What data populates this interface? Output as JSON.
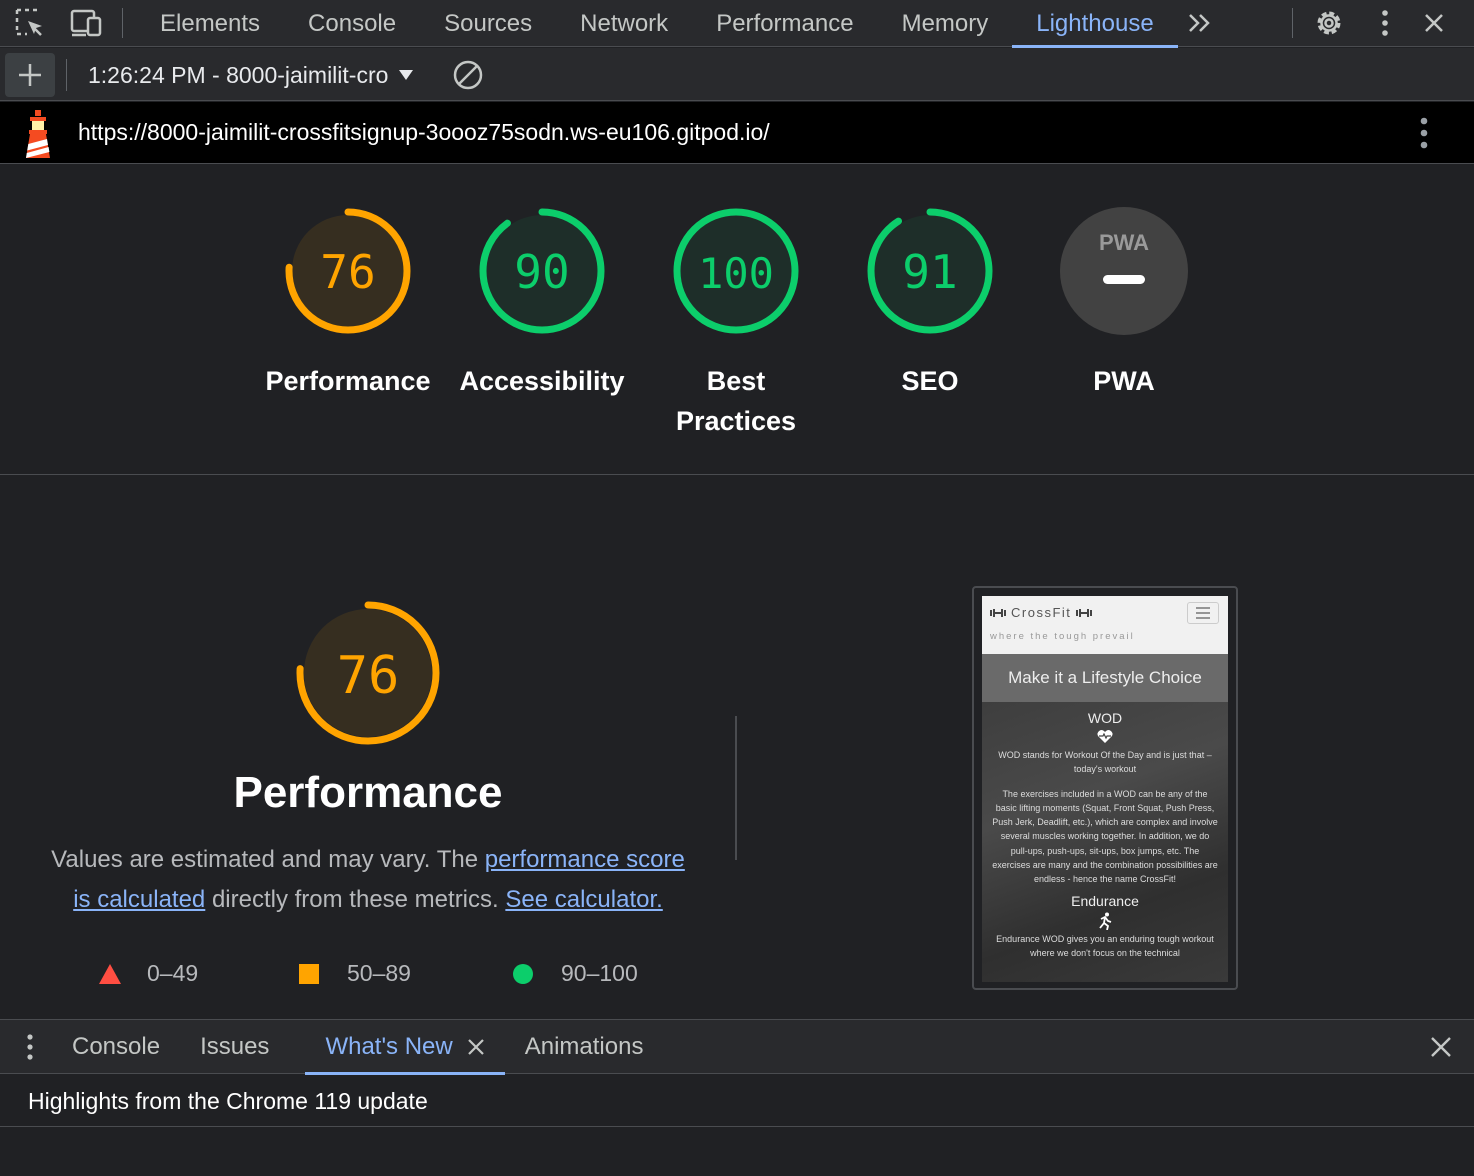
{
  "colors": {
    "pass": "#0cce6b",
    "average": "#ffa400",
    "fail": "#ff4e42",
    "accent": "#8ab4f8"
  },
  "devtools": {
    "icons": [
      "inspect-element-icon",
      "device-toolbar-icon",
      "more-tabs-icon",
      "settings-icon",
      "more-options-icon",
      "close-icon"
    ],
    "tabs": [
      {
        "label": "Elements"
      },
      {
        "label": "Console"
      },
      {
        "label": "Sources"
      },
      {
        "label": "Network"
      },
      {
        "label": "Performance"
      },
      {
        "label": "Memory"
      },
      {
        "label": "Lighthouse",
        "active": true
      }
    ]
  },
  "lighthouse_toolbar": {
    "report_label": "1:26:24 PM - 8000-jaimilit-cro"
  },
  "report": {
    "url": "https://8000-jaimilit-crossfitsignup-3oooz75sodn.ws-eu106.gitpod.io/",
    "categories": [
      {
        "label": "Performance",
        "score": 76,
        "rating": "average"
      },
      {
        "label": "Accessibility",
        "score": 90,
        "rating": "pass"
      },
      {
        "label_line1": "Best",
        "label_line2": "Practices",
        "score": 100,
        "rating": "pass"
      },
      {
        "label": "SEO",
        "score": 91,
        "rating": "pass"
      },
      {
        "label": "PWA",
        "badge": "PWA",
        "rating": "na"
      }
    ],
    "performance": {
      "score": 76,
      "title": "Performance",
      "desc_before": "Values are estimated and may vary. The ",
      "link1": "performance score is calculated",
      "desc_middle": " directly from these metrics. ",
      "link2": "See calculator.",
      "legend": [
        {
          "range": "0–49",
          "shape": "triangle"
        },
        {
          "range": "50–89",
          "shape": "square"
        },
        {
          "range": "90–100",
          "shape": "circle"
        }
      ]
    },
    "screenshot": {
      "brand": "CrossFit",
      "tagline": "where the tough prevail",
      "heading": "Make it a Lifestyle Choice",
      "section1_title": "WOD",
      "section1_p1": "WOD stands for Workout Of the Day and is just that – today's workout",
      "section1_p2": "The exercises included in a WOD can be any of the basic lifting moments (Squat, Front Squat, Push Press, Push Jerk, Deadlift, etc.), which are complex and involve several muscles working together. In addition, we do pull-ups, push-ups, sit-ups, box jumps, etc. The exercises are many and the combination possibilities are endless - hence the name CrossFit!",
      "section2_title": "Endurance",
      "section2_p1": "Endurance WOD gives you an enduring tough workout where we don't focus on the technical"
    }
  },
  "drawer": {
    "tabs": [
      {
        "label": "Console"
      },
      {
        "label": "Issues"
      },
      {
        "label": "What's New",
        "active": true,
        "closable": true
      },
      {
        "label": "Animations"
      }
    ],
    "content": "Highlights from the Chrome 119 update"
  }
}
